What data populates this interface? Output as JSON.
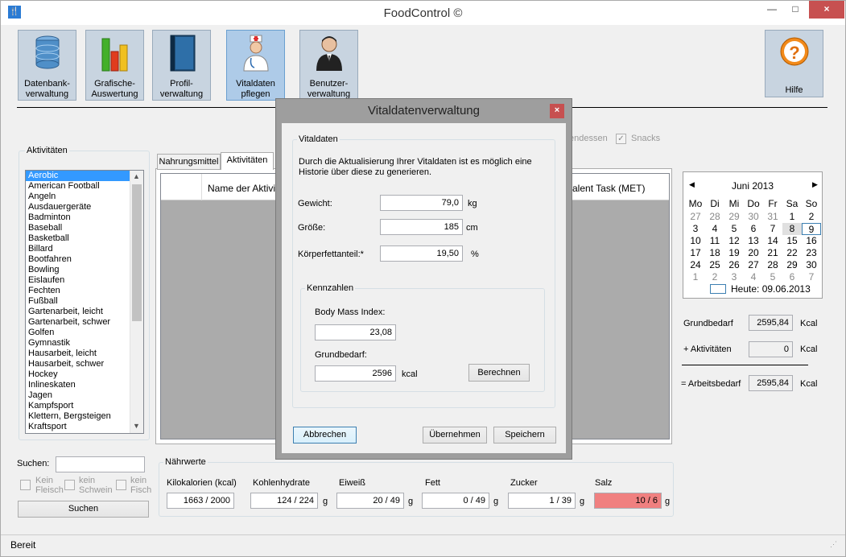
{
  "window": {
    "title": "FoodControl ©",
    "app_icon": "fork-knife-icon",
    "min": "—",
    "max": "□",
    "close": "×"
  },
  "toolbar": [
    {
      "id": "db",
      "line1": "Datenbank-",
      "line2": "verwaltung",
      "icon": "database-icon"
    },
    {
      "id": "chart",
      "line1": "Grafische-",
      "line2": "Auswertung",
      "icon": "bar-chart-icon"
    },
    {
      "id": "profile",
      "line1": "Profil-",
      "line2": "verwaltung",
      "icon": "book-icon"
    },
    {
      "id": "vital",
      "line1": "Vitaldaten",
      "line2": "pflegen",
      "icon": "doctor-icon"
    },
    {
      "id": "user",
      "line1": "Benutzer-",
      "line2": "verwaltung",
      "icon": "user-icon"
    }
  ],
  "help": {
    "label": "Hilfe",
    "icon": "question-icon"
  },
  "activities": {
    "group_title": "Aktivitäten",
    "items": [
      "Aerobic",
      "American Football",
      "Angeln",
      "Ausdauergeräte",
      "Badminton",
      "Baseball",
      "Basketball",
      "Billard",
      "Bootfahren",
      "Bowling",
      "Eislaufen",
      "Fechten",
      "Fußball",
      "Gartenarbeit, leicht",
      "Gartenarbeit, schwer",
      "Golfen",
      "Gymnastik",
      "Hausarbeit, leicht",
      "Hausarbeit, schwer",
      "Hockey",
      "Inlineskaten",
      "Jagen",
      "Kampfsport",
      "Klettern, Bergsteigen",
      "Kraftsport"
    ],
    "selected": "Aerobic"
  },
  "search": {
    "label": "Suchen:",
    "value": "",
    "kein_fleisch": [
      "Kein",
      "Fleisch"
    ],
    "kein_schwein": [
      "kein",
      "Schwein"
    ],
    "kein_fisch": [
      "kein",
      "Fisch"
    ],
    "button": "Suchen"
  },
  "tabs": {
    "t1": "Nahrungsmittel",
    "t2": "Aktivitäten"
  },
  "grid": {
    "col1": "Name der Aktivität",
    "col2": "Equivalent Task (MET)",
    "col2_visible": "valent Task (MET)",
    "col1_visible": "Name der Aktivität"
  },
  "meals": {
    "abendessen": "endessen",
    "snacks": "Snacks"
  },
  "calendar": {
    "month": "Juni 2013",
    "days": [
      "Mo",
      "Di",
      "Mi",
      "Do",
      "Fr",
      "Sa",
      "So"
    ],
    "rows": [
      [
        "27",
        "28",
        "29",
        "30",
        "31",
        "1",
        "2"
      ],
      [
        "3",
        "4",
        "5",
        "6",
        "7",
        "8",
        "9"
      ],
      [
        "10",
        "11",
        "12",
        "13",
        "14",
        "15",
        "16"
      ],
      [
        "17",
        "18",
        "19",
        "20",
        "21",
        "22",
        "23"
      ],
      [
        "24",
        "25",
        "26",
        "27",
        "28",
        "29",
        "30"
      ],
      [
        "1",
        "2",
        "3",
        "4",
        "5",
        "6",
        "7"
      ]
    ],
    "today_label": "Heute: 09.06.2013"
  },
  "summary": {
    "grundbedarf_label": "Grundbedarf",
    "grundbedarf": "2595,84",
    "unit": "Kcal",
    "akt_label": "+ Aktivitäten",
    "akt": "0",
    "arbeits_label": "= Arbeitsbedarf",
    "arbeits": "2595,84"
  },
  "naehrwerte": {
    "title": "Nährwerte",
    "kcal_label": "Kilokalorien (kcal)",
    "kcal": "1663 / 2000",
    "kh_label": "Kohlenhydrate",
    "kh": "124 / 224",
    "eiweiss_label": "Eiweiß",
    "eiweiss": "20 / 49",
    "fett_label": "Fett",
    "fett": "0 / 49",
    "zucker_label": "Zucker",
    "zucker": "1 / 39",
    "salz_label": "Salz",
    "salz": "10 / 6",
    "unit_g": "g",
    "warn_color": "#f08080"
  },
  "status": {
    "text": "Bereit"
  },
  "dialog": {
    "title": "Vitaldatenverwaltung",
    "close": "×",
    "group": "Vitaldaten",
    "info": [
      "Durch die Aktualisierung Ihrer Vitaldaten ist es möglich eine",
      "Historie über diese zu generieren."
    ],
    "gewicht_label": "Gewicht:",
    "gewicht": "79,0",
    "gewicht_unit": "kg",
    "groesse_label": "Größe:",
    "groesse": "185",
    "groesse_unit": "cm",
    "kfa_label": "Körperfettanteil:*",
    "kfa": "19,50",
    "kfa_unit": "%",
    "kennzahlen": "Kennzahlen",
    "bmi_label": "Body Mass Index:",
    "bmi": "23,08",
    "gb_label": "Grundbedarf:",
    "gb": "2596",
    "gb_unit": "kcal",
    "berechnen": "Berechnen",
    "abbrechen": "Abbrechen",
    "uebernehmen": "Übernehmen",
    "speichern": "Speichern"
  }
}
